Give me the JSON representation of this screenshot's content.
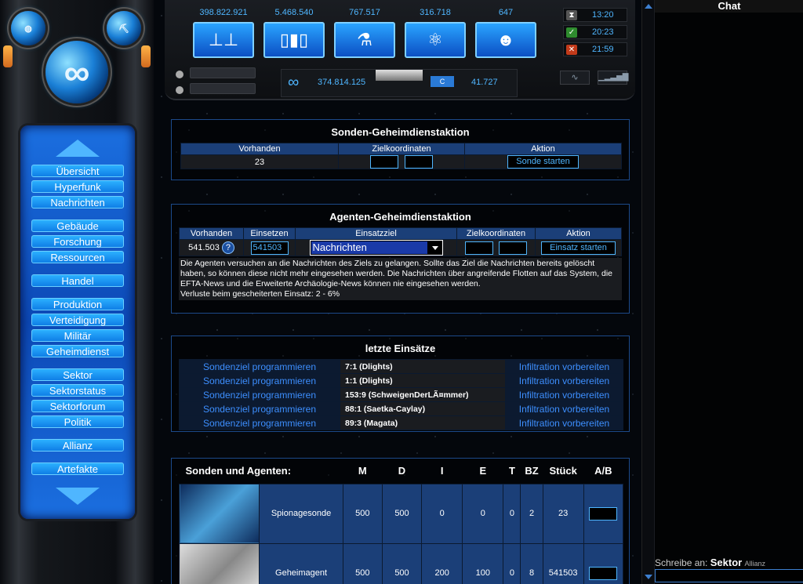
{
  "nav": {
    "items": [
      "Übersicht",
      "Hyperfunk",
      "Nachrichten",
      "Gebäude",
      "Forschung",
      "Ressourcen",
      "Handel",
      "Produktion",
      "Verteidigung",
      "Militär",
      "Geheimdienst",
      "Sektor",
      "Sektorstatus",
      "Sektorforum",
      "Politik",
      "Allianz",
      "Artefakte"
    ]
  },
  "resources": [
    {
      "value": "398.822.921",
      "icon": "metal-icon"
    },
    {
      "value": "5.468.540",
      "icon": "crystal-icon"
    },
    {
      "value": "767.517",
      "icon": "flask-icon"
    },
    {
      "value": "316.718",
      "icon": "atom-icon"
    },
    {
      "value": "647",
      "icon": "population-icon"
    }
  ],
  "clocks": [
    {
      "time": "13:20",
      "icon": "hourglass-icon",
      "color": "#555555"
    },
    {
      "time": "20:23",
      "icon": "check-icon",
      "color": "#2e8b2e"
    },
    {
      "time": "21:59",
      "icon": "cross-icon",
      "color": "#c23a1a"
    }
  ],
  "credits": {
    "value": "374.814.125",
    "c_label": "C",
    "c_value": "41.727"
  },
  "sonden": {
    "title": "Sonden-Geheimdienstaktion",
    "headers": [
      "Vorhanden",
      "Zielkoordinaten",
      "Aktion"
    ],
    "vorhanden": "23",
    "button": "Sonde starten"
  },
  "agenten": {
    "title": "Agenten-Geheimdienstaktion",
    "headers": [
      "Vorhanden",
      "Einsetzen",
      "Einsatzziel",
      "Zielkoordinaten",
      "Aktion"
    ],
    "vorhanden": "541.503",
    "einsetzen": "541503",
    "einsatzziel": "Nachrichten",
    "button": "Einsatz starten",
    "description": "Die Agenten versuchen an die Nachrichten des Ziels zu gelangen. Sollte das Ziel die Nachrichten bereits gelöscht haben, so können diese nicht mehr eingesehen werden. Die Nachrichten über angreifende Flotten auf das System, die EFTA-News und die Erweiterte Archäologie-News können nie eingesehen werden.",
    "verluste": "Verluste beim gescheiterten Einsatz: 2 - 6%"
  },
  "letzte": {
    "title": "letzte Einsätze",
    "rows": [
      {
        "left": "Sondenziel programmieren",
        "target": "7:1 (Dlights)",
        "right": "Infiltration vorbereiten"
      },
      {
        "left": "Sondenziel programmieren",
        "target": "1:1 (Dlights)",
        "right": "Infiltration vorbereiten"
      },
      {
        "left": "Sondenziel programmieren",
        "target": "153:9 (SchweigenDerLÃ¤mmer)",
        "right": "Infiltration vorbereiten"
      },
      {
        "left": "Sondenziel programmieren",
        "target": "88:1 (Saetka-Caylay)",
        "right": "Infiltration vorbereiten"
      },
      {
        "left": "Sondenziel programmieren",
        "target": "89:3 (Magata)",
        "right": "Infiltration vorbereiten"
      }
    ]
  },
  "units": {
    "title": "Sonden und Agenten:",
    "headers": [
      "M",
      "D",
      "I",
      "E",
      "T",
      "BZ",
      "Stück",
      "A/B"
    ],
    "rows": [
      {
        "name": "Spionagesonde",
        "m": "500",
        "d": "500",
        "i": "0",
        "e": "0",
        "t": "0",
        "bz": "2",
        "stueck": "23"
      },
      {
        "name": "Geheimagent",
        "m": "500",
        "d": "500",
        "i": "200",
        "e": "100",
        "t": "0",
        "bz": "8",
        "stueck": "541503"
      }
    ]
  },
  "chat": {
    "title": "Chat",
    "prompt": "Schreibe an:",
    "target": "Sektor",
    "alt": "Allianz"
  }
}
